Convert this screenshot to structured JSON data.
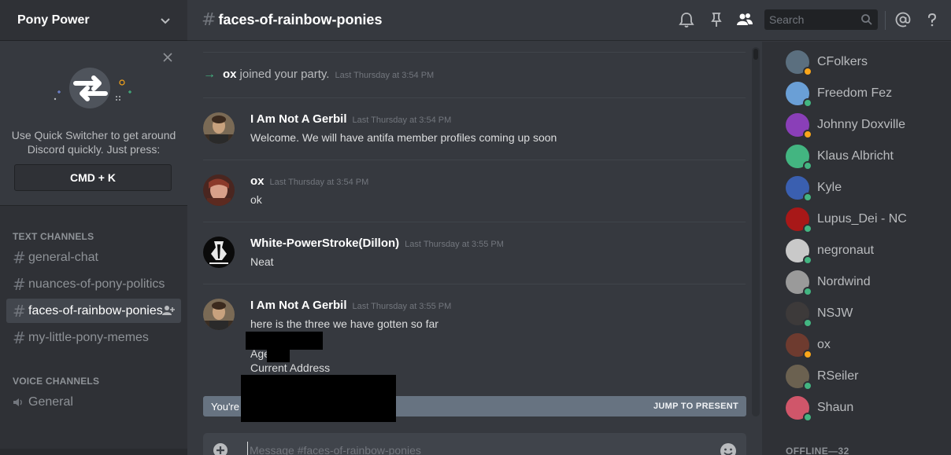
{
  "server": {
    "name": "Pony Power"
  },
  "quick_switcher": {
    "text": "Use Quick Switcher to get around Discord quickly. Just press:",
    "shortcut": "CMD + K"
  },
  "categories": {
    "text": "TEXT CHANNELS",
    "voice": "VOICE CHANNELS"
  },
  "text_channels": [
    {
      "name": "general-chat"
    },
    {
      "name": "nuances-of-pony-politics"
    },
    {
      "name": "faces-of-rainbow-ponies",
      "selected": true
    },
    {
      "name": "my-little-pony-memes"
    }
  ],
  "voice_channels": [
    {
      "name": "General"
    }
  ],
  "topbar": {
    "channel": "faces-of-rainbow-ponies",
    "search_placeholder": "Search"
  },
  "system_message": {
    "name": "ox",
    "text": "joined your party.",
    "timestamp": "Last Thursday at 3:54 PM"
  },
  "messages": [
    {
      "author": "I Am Not A Gerbil",
      "timestamp": "Last Thursday at 3:54 PM",
      "lines": [
        "Welcome. We will have antifa member profiles coming up soon"
      ]
    },
    {
      "author": "ox",
      "timestamp": "Last Thursday at 3:54 PM",
      "lines": [
        "ok"
      ]
    },
    {
      "author": "White-PowerStroke(Dillon)",
      "timestamp": "Last Thursday at 3:55 PM",
      "lines": [
        "Neat"
      ]
    },
    {
      "author": "I Am Not A Gerbil",
      "timestamp": "Last Thursday at 3:55 PM",
      "lines": [
        "here is the three we have gotten so far",
        "",
        "Age",
        "Current Address"
      ]
    }
  ],
  "jump_bar": {
    "text": "You're",
    "action": "JUMP TO PRESENT"
  },
  "composer": {
    "placeholder": "Message #faces-of-rainbow-ponies"
  },
  "members": [
    {
      "name": "CFolkers",
      "status": "idle",
      "color": "#5b6f7f"
    },
    {
      "name": "Freedom Fez",
      "status": "online",
      "color": "#6a9fd6"
    },
    {
      "name": "Johnny Doxville",
      "status": "idle",
      "color": "#8a3fb8"
    },
    {
      "name": "Klaus Albricht",
      "status": "online",
      "color": "#43b581"
    },
    {
      "name": "Kyle",
      "status": "online",
      "color": "#3a5fb0"
    },
    {
      "name": "Lupus_Dei - NC",
      "status": "online",
      "color": "#a81818"
    },
    {
      "name": "negronaut",
      "status": "online",
      "color": "#c9c9c9"
    },
    {
      "name": "Nordwind",
      "status": "online",
      "color": "#9a9a9a"
    },
    {
      "name": "NSJW",
      "status": "online",
      "color": "#3d3a3a"
    },
    {
      "name": "ox",
      "status": "idle",
      "color": "#6e3b2f"
    },
    {
      "name": "RSeiler",
      "status": "online",
      "color": "#6b6150"
    },
    {
      "name": "Shaun",
      "status": "online",
      "color": "#d0566a"
    }
  ],
  "offline_label": "OFFLINE—32",
  "colors": {
    "accent_green": "#43b581",
    "idle": "#faa61a",
    "jump_bar": "#677381"
  }
}
